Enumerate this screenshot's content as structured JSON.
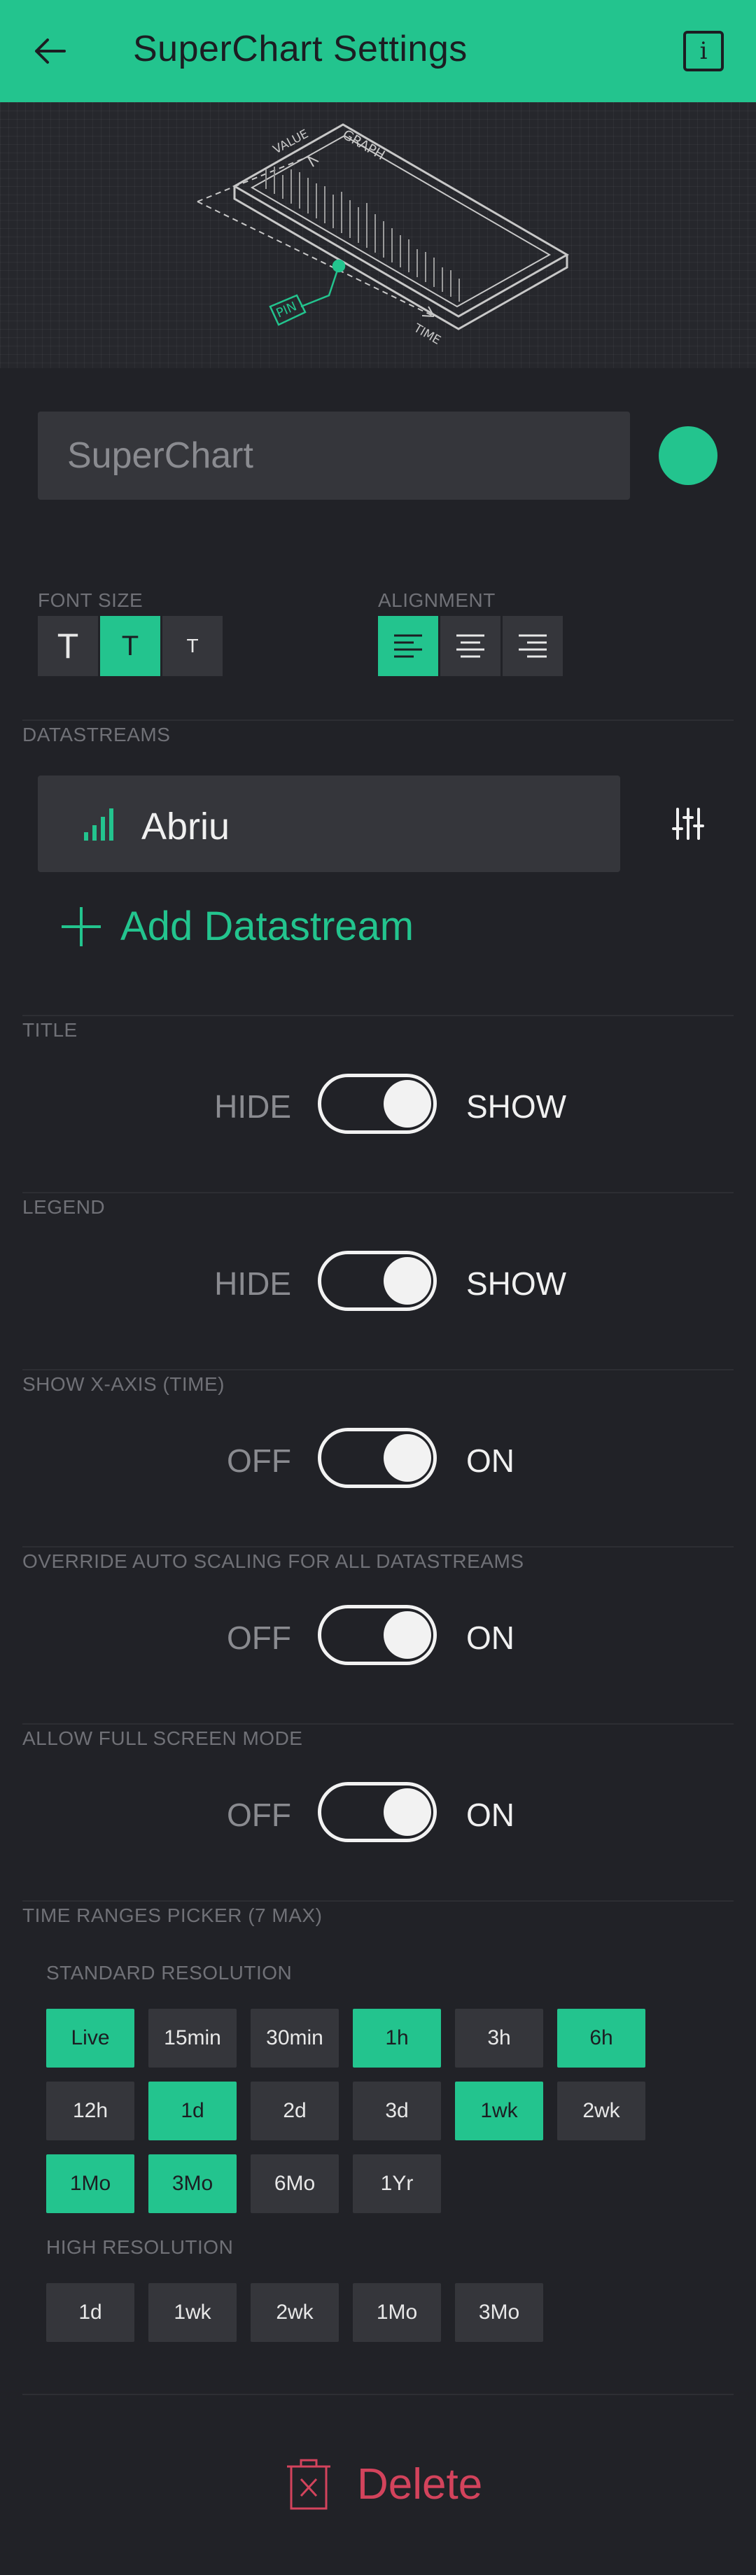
{
  "header": {
    "title": "SuperChart Settings",
    "back_icon": "arrow-left-icon",
    "info_icon": "info-icon",
    "info_glyph": "i",
    "background": "#23c48e"
  },
  "illustration": {
    "value_label": "VALUE",
    "graph_label": "GRAPH",
    "pin_label": "PIN",
    "time_label": "TIME"
  },
  "name_field": {
    "value": "SuperChart",
    "color": "#23c48e"
  },
  "font_size": {
    "label": "FONT SIZE",
    "options": [
      "T",
      "T",
      "T"
    ],
    "selected_index": 1
  },
  "alignment": {
    "label": "ALIGNMENT",
    "options": [
      "align-left-icon",
      "align-center-icon",
      "align-right-icon"
    ],
    "selected_index": 0
  },
  "datastreams": {
    "label": "DATASTREAMS",
    "items": [
      {
        "name": "Abriu",
        "icon": "bar-chart-icon"
      }
    ],
    "settings_icon": "sliders-icon",
    "add_label": "Add Datastream"
  },
  "toggles": [
    {
      "section": "TITLE",
      "off": "HIDE",
      "on": "SHOW",
      "state": "on"
    },
    {
      "section": "LEGEND",
      "off": "HIDE",
      "on": "SHOW",
      "state": "on"
    },
    {
      "section": "SHOW X-AXIS (TIME)",
      "off": "OFF",
      "on": "ON",
      "state": "on"
    },
    {
      "section": "OVERRIDE AUTO SCALING FOR ALL DATASTREAMS",
      "off": "OFF",
      "on": "ON",
      "state": "on"
    },
    {
      "section": "ALLOW FULL SCREEN MODE",
      "off": "OFF",
      "on": "ON",
      "state": "on"
    }
  ],
  "time_ranges": {
    "label": "TIME RANGES PICKER (7 MAX)",
    "standard_label": "STANDARD RESOLUTION",
    "standard": [
      {
        "label": "Live",
        "selected": true
      },
      {
        "label": "15min",
        "selected": false
      },
      {
        "label": "30min",
        "selected": false
      },
      {
        "label": "1h",
        "selected": true
      },
      {
        "label": "3h",
        "selected": false
      },
      {
        "label": "6h",
        "selected": true
      },
      {
        "label": "12h",
        "selected": false
      },
      {
        "label": "1d",
        "selected": true
      },
      {
        "label": "2d",
        "selected": false
      },
      {
        "label": "3d",
        "selected": false
      },
      {
        "label": "1wk",
        "selected": true
      },
      {
        "label": "2wk",
        "selected": false
      },
      {
        "label": "1Mo",
        "selected": true
      },
      {
        "label": "3Mo",
        "selected": true
      },
      {
        "label": "6Mo",
        "selected": false
      },
      {
        "label": "1Yr",
        "selected": false
      }
    ],
    "high_label": "HIGH RESOLUTION",
    "high": [
      {
        "label": "1d",
        "selected": false
      },
      {
        "label": "1wk",
        "selected": false
      },
      {
        "label": "2wk",
        "selected": false
      },
      {
        "label": "1Mo",
        "selected": false
      },
      {
        "label": "3Mo",
        "selected": false
      }
    ]
  },
  "delete": {
    "label": "Delete",
    "icon": "trash-icon",
    "color": "#d3435c"
  },
  "colors": {
    "accent": "#23c48e",
    "background": "#212227",
    "surface": "#35363b",
    "danger": "#d3435c"
  }
}
